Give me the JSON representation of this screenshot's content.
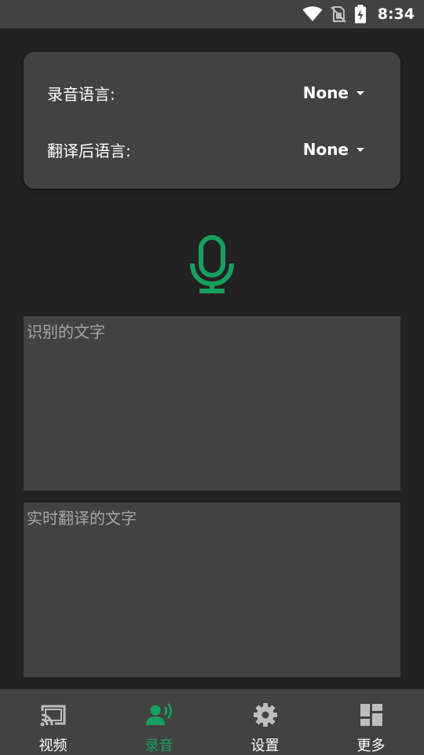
{
  "status_bar": {
    "time": "8:34",
    "icons": [
      "wifi-icon",
      "no-sim-icon",
      "battery-charging-icon"
    ]
  },
  "language_card": {
    "record_language_label": "录音语言:",
    "record_language_value": "None",
    "translate_language_label": "翻译后语言:",
    "translate_language_value": "None"
  },
  "mic": {
    "icon": "microphone-icon",
    "color": "#17a05d"
  },
  "recognized_text": {
    "placeholder": "识别的文字"
  },
  "translated_text": {
    "placeholder": "实时翻译的文字"
  },
  "bottom_nav": {
    "items": [
      {
        "label": "视频",
        "icon": "cast-icon",
        "active": false
      },
      {
        "label": "录音",
        "icon": "voice-record-icon",
        "active": true
      },
      {
        "label": "设置",
        "icon": "gear-icon",
        "active": false
      },
      {
        "label": "更多",
        "icon": "dashboard-icon",
        "active": false
      }
    ],
    "active_color": "#17a05d"
  }
}
